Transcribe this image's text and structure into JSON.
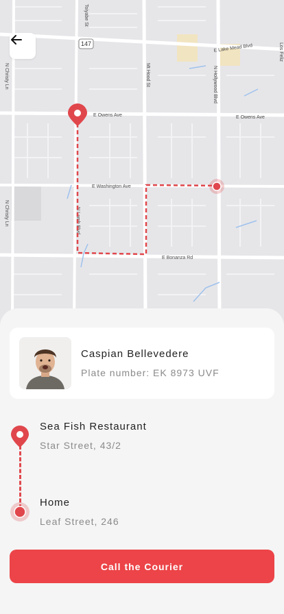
{
  "map": {
    "streets": {
      "toyabe": "Toiyabe St",
      "hwy147": "147",
      "lake_mead": "E Lake Mead Blvd",
      "los_feliz": "Los Feliz",
      "christy": "N Christy Ln",
      "mt_hood": "Mt Hood St",
      "hollywood": "N Hollywood Blvd",
      "owens_left": "E Owens Ave",
      "owens_right": "E Owens Ave",
      "washington": "E Washington Ave",
      "bonanza": "E Bonanza Rd",
      "christy_lower": "N Christy Ln",
      "lamb": "N Lamb Blvd"
    },
    "route_color": "#e0474c"
  },
  "courier": {
    "name": "Caspian Bellevedere",
    "plate": "Plate number: EK 8973 UVF"
  },
  "pickup": {
    "title": "Sea Fish Restaurant",
    "address": "Star Street, 43/2"
  },
  "dropoff": {
    "title": "Home",
    "address": "Leaf Street, 246"
  },
  "actions": {
    "call_label": "Call the Courier"
  },
  "colors": {
    "accent": "#ec4448",
    "sheet": "#f5f5f5",
    "map_bg": "#e6e6e9"
  }
}
